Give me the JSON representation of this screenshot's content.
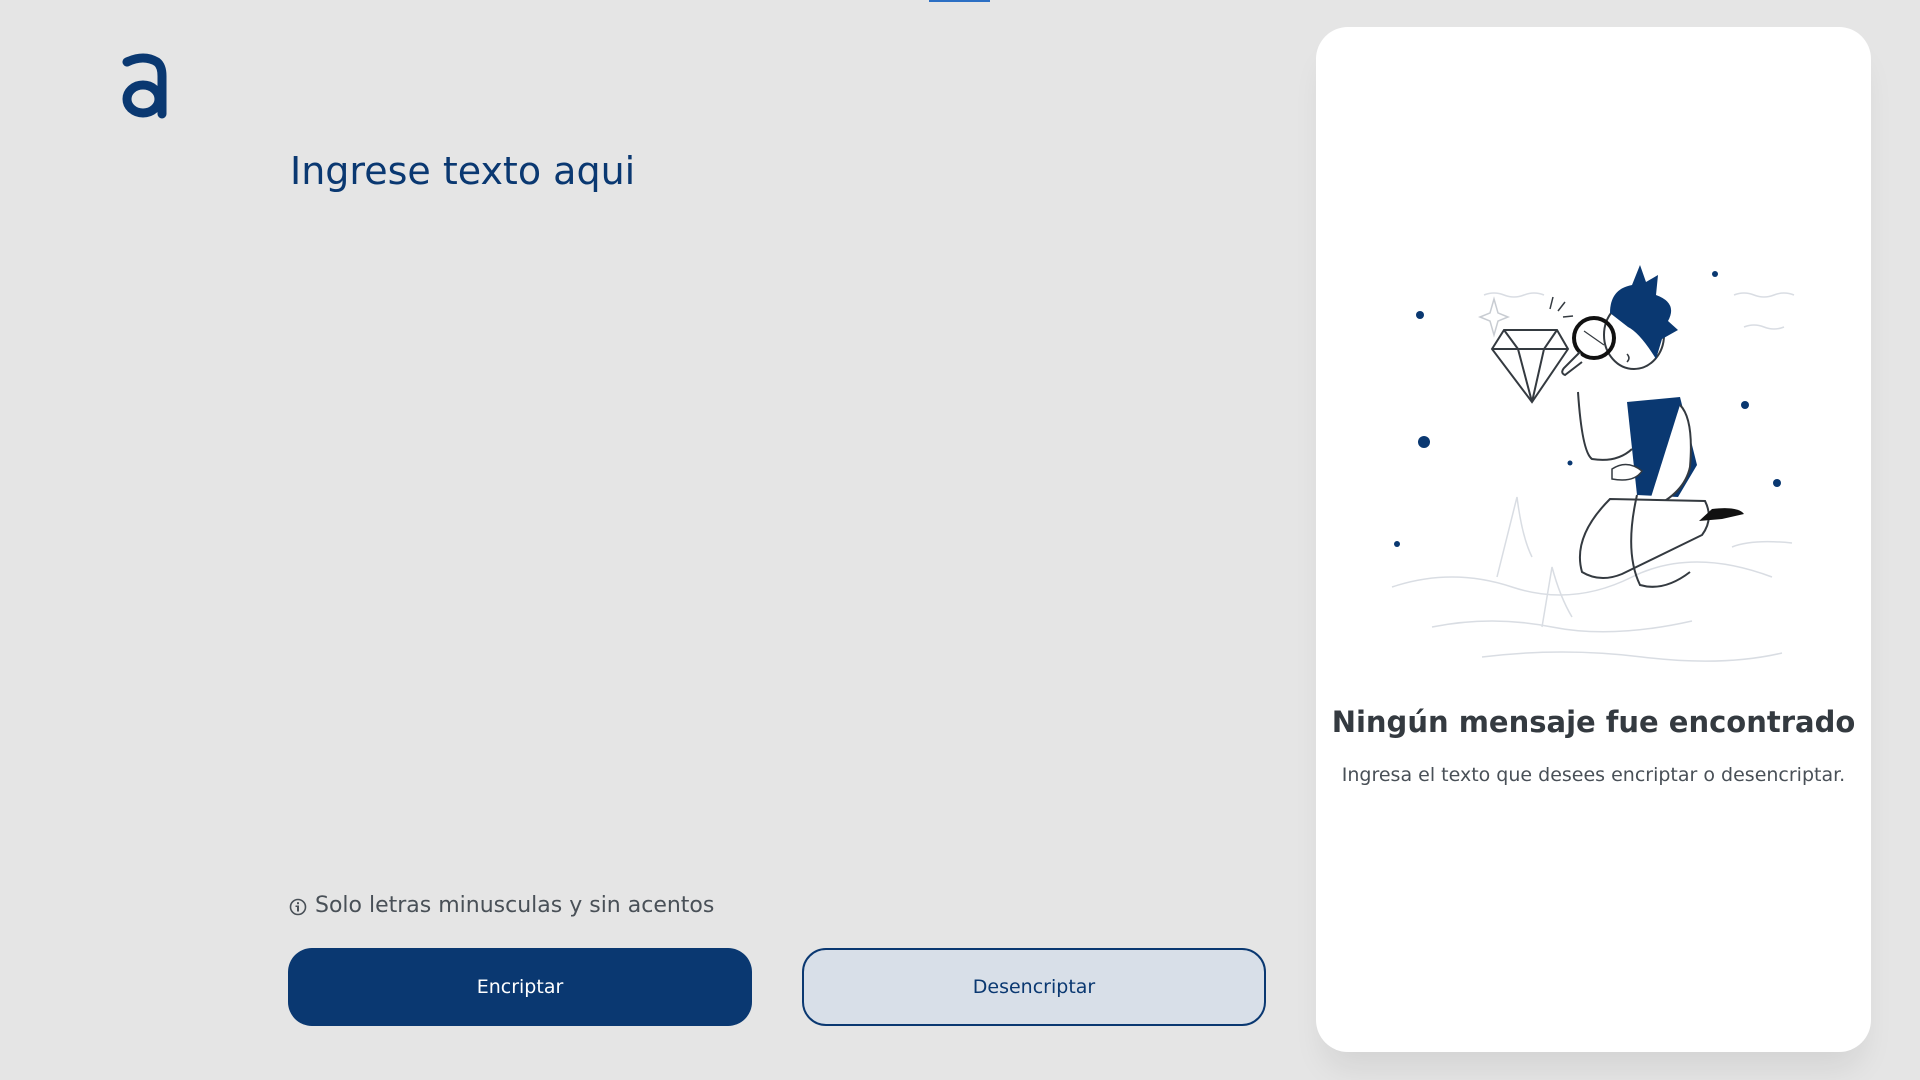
{
  "header": {
    "logo_icon": "alura-a-logo-icon"
  },
  "input": {
    "placeholder": "Ingrese texto aqui",
    "value": ""
  },
  "hint": {
    "icon": "info-icon",
    "text": "Solo letras minusculas y sin acentos"
  },
  "buttons": {
    "encrypt_label": "Encriptar",
    "decrypt_label": "Desencriptar"
  },
  "output": {
    "illustration": "person-with-magnifying-glass-illustration",
    "title": "Ningún mensaje fue encontrado",
    "subtitle": "Ingresa el texto que desees encriptar o desencriptar."
  },
  "colors": {
    "background": "#e5e5e5",
    "primary": "#0a3871",
    "card": "#ffffff",
    "secondary_button_bg": "#d8dfe8",
    "title_text": "#343a40",
    "body_text": "#495057"
  }
}
